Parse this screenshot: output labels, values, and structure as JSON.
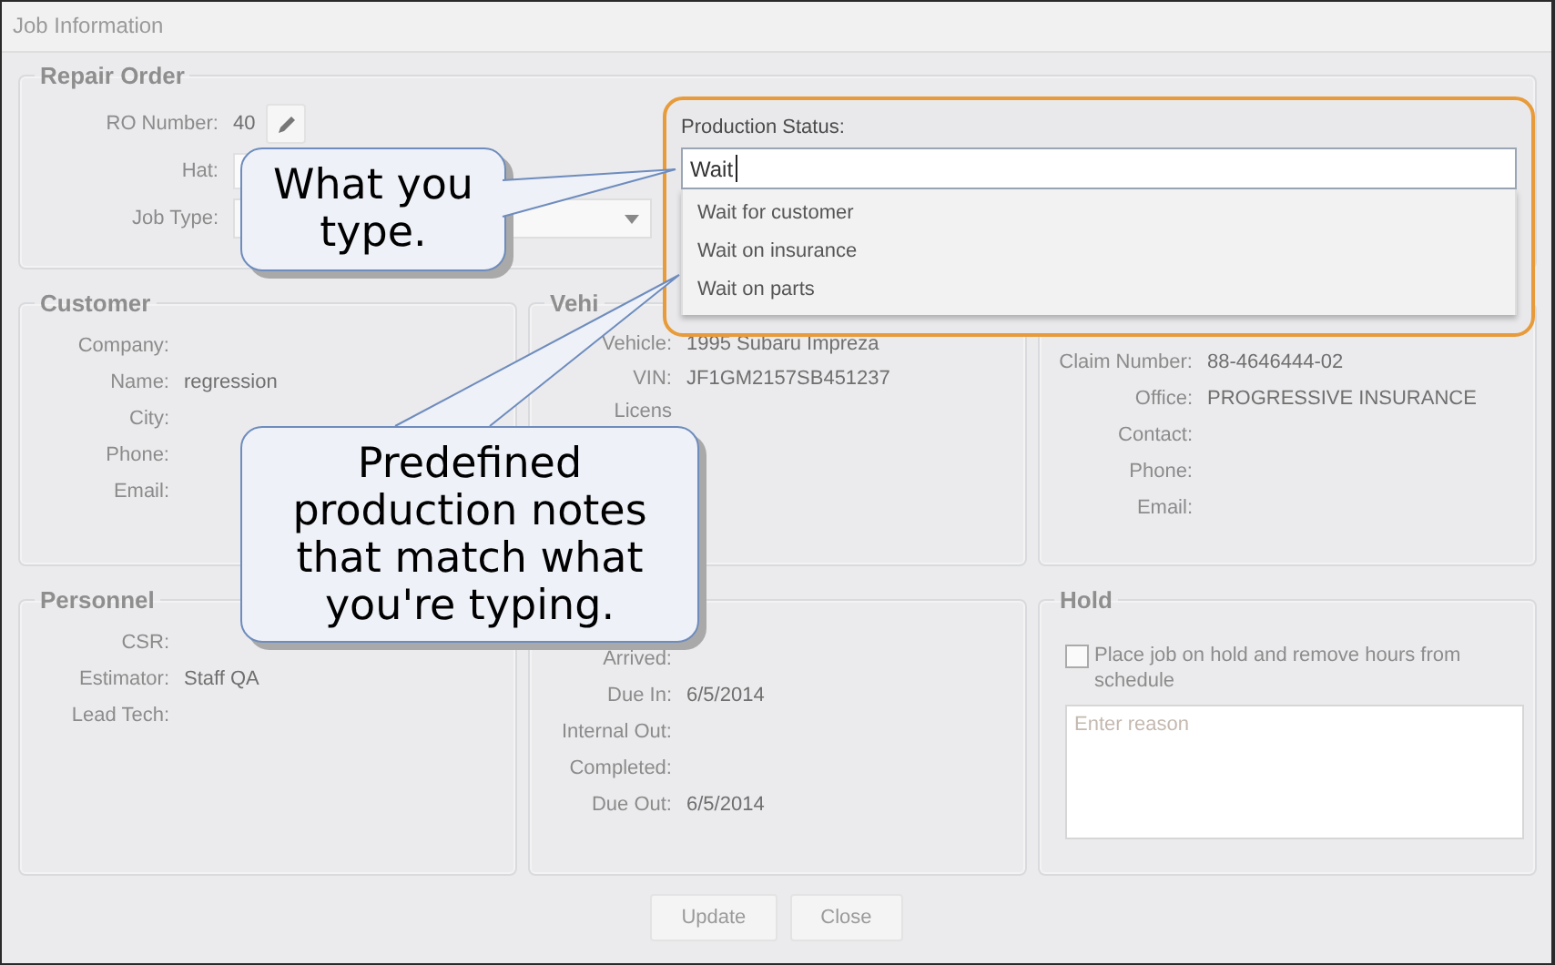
{
  "window": {
    "title": "Job Information"
  },
  "repair_order": {
    "title": "Repair Order",
    "fields": [
      {
        "label": "RO Number:",
        "value": "40",
        "kind": "text"
      },
      {
        "label": "Hat:",
        "kind": "input"
      },
      {
        "label": "Job Type:",
        "kind": "select"
      }
    ]
  },
  "customer": {
    "title": "Customer",
    "fields": [
      {
        "label": "Company:"
      },
      {
        "label": "Name:",
        "value": "regression"
      },
      {
        "label": "City:"
      },
      {
        "label": "Phone:"
      },
      {
        "label": "Email:"
      }
    ]
  },
  "vehicle": {
    "title": "Vehi",
    "fields": [
      {
        "label": "Vehicle:",
        "value": "1995 Subaru Impreza"
      },
      {
        "label": "VIN:",
        "value": "JF1GM2157SB451237"
      },
      {
        "label": "Licens"
      }
    ]
  },
  "insurance": {
    "fields": [
      {
        "label": "Claim Number:",
        "value": "88-4646444-02"
      },
      {
        "label": "Office:",
        "value": "PROGRESSIVE INSURANCE"
      },
      {
        "label": "Contact:"
      },
      {
        "label": "Phone:"
      },
      {
        "label": "Email:"
      }
    ]
  },
  "personnel": {
    "title": "Personnel",
    "fields": [
      {
        "label": "CSR:"
      },
      {
        "label": "Estimator:",
        "value": "Staff QA"
      },
      {
        "label": "Lead Tech:"
      }
    ]
  },
  "dates": {
    "fields": [
      {
        "label": "Arrived:"
      },
      {
        "label": "Due In:",
        "value": "6/5/2014"
      },
      {
        "label": "Internal Out:"
      },
      {
        "label": "Completed:"
      },
      {
        "label": "Due Out:",
        "value": "6/5/2014"
      }
    ]
  },
  "hold": {
    "title": "Hold",
    "checkbox": {
      "label": "Place job on hold and remove hours from schedule",
      "checked": false
    },
    "reason": {
      "placeholder": "Enter reason"
    }
  },
  "buttons": [
    "Update",
    "Close"
  ],
  "production_status": {
    "label": "Production Status:",
    "value": "Wait",
    "suggestions": [
      {
        "text": "Wait for customer",
        "selected": false
      },
      {
        "text": "Wait on insurance",
        "selected": false
      },
      {
        "text": "Wait on parts",
        "selected": false
      }
    ]
  },
  "callouts": [
    {
      "text": "What you type."
    },
    {
      "text": "Predefined production notes that match what you're typing."
    }
  ]
}
